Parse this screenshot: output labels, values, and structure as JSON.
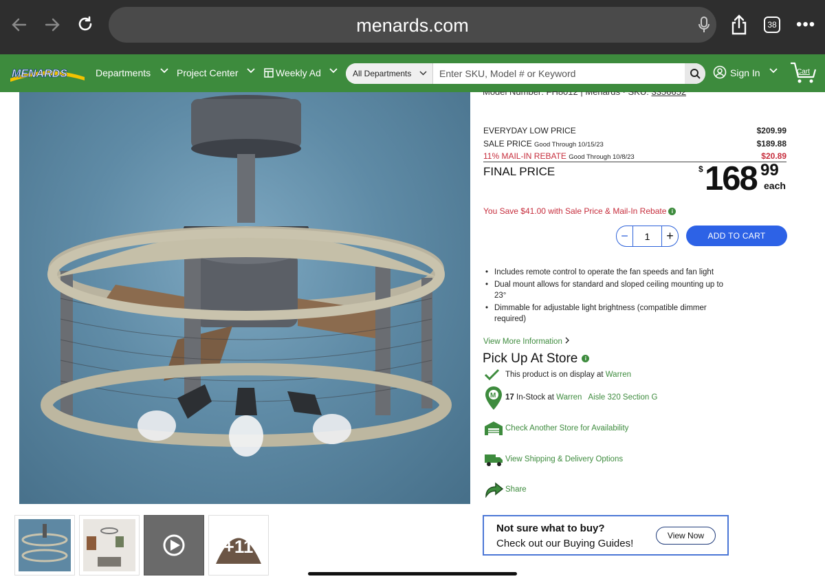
{
  "browser": {
    "url": "menards.com",
    "tabs_count": "38",
    "icons": [
      "back-arrow-icon",
      "forward-arrow-icon",
      "reload-icon",
      "microphone-icon",
      "share-icon",
      "tabs-icon",
      "more-icon"
    ]
  },
  "header": {
    "logo_text": "MENARDS",
    "nav": [
      "Departments",
      "Project Center",
      "Weekly Ad"
    ],
    "search": {
      "department": "All Departments",
      "placeholder": "Enter SKU, Model # or Keyword"
    },
    "sign_in": "Sign In",
    "cart": "Cart",
    "brand_color": "#3d8b3d"
  },
  "product": {
    "model_line": {
      "model_label": "Model Number:",
      "model_value": "FH8012",
      "brand": "Menards",
      "sku_label": "SKU:",
      "sku_value": "3356652"
    },
    "thumbs_more": "+11",
    "pricing": {
      "everyday_label": "EVERYDAY LOW PRICE",
      "everyday_value": "$209.99",
      "sale_label": "SALE PRICE",
      "sale_note": "Good Through 10/15/23",
      "sale_value": "$189.88",
      "rebate_label": "11% MAIL-IN REBATE",
      "rebate_note": "Good Through 10/8/23",
      "rebate_value": "$20.89",
      "final_label": "FINAL PRICE",
      "final_currency": "$",
      "final_whole": "168",
      "final_cents": "99",
      "final_unit": "each",
      "you_save": "You Save $41.00 with Sale Price & Mail-In Rebate",
      "rebate_color": "#c62d3c"
    },
    "quantity": "1",
    "add_to_cart": "ADD TO CART",
    "features": [
      "Includes remote control to operate the fan speeds and fan light",
      "Dual mount allows for standard and sloped ceiling mounting up to 23°",
      "Dimmable for adjustable light brightness (compatible dimmer required)"
    ],
    "view_more": "View More Information",
    "pickup": {
      "title": "Pick Up At Store",
      "display_text": "This product is on display at",
      "store": "Warren",
      "stock_count": "17",
      "stock_text": "In-Stock at",
      "aisle": "Aisle 320 Section G",
      "check_store": "Check Another Store for Availability",
      "shipping": "View Shipping & Delivery Options",
      "share": "Share"
    },
    "buying_guide": {
      "line1": "Not sure what to buy?",
      "line2": "Check out our Buying Guides!",
      "button": "View Now"
    }
  }
}
